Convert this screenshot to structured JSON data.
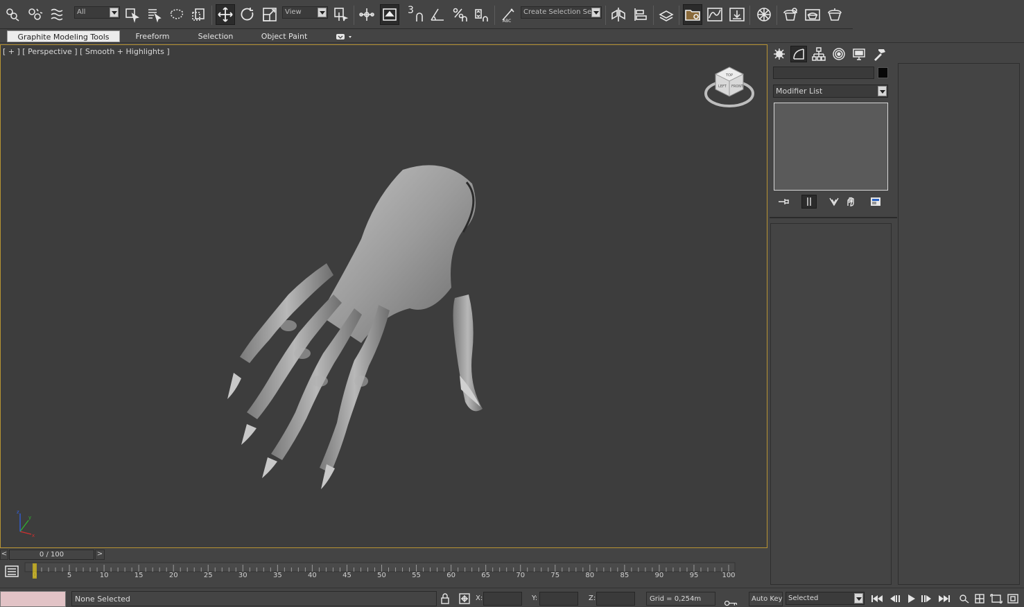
{
  "toolbar": {
    "selection_filter": "All",
    "ref_coord_system": "View",
    "named_selection_set": "Create Selection Se",
    "snap_label": "3",
    "icons": [
      "link-icon",
      "unlink-icon",
      "bind-spacewarp-icon",
      "select-object-icon",
      "select-by-name-icon",
      "rect-selection-icon",
      "window-crossing-icon",
      "select-move-icon",
      "select-rotate-icon",
      "select-scale-icon",
      "use-pivot-icon",
      "select-manipulate-icon",
      "keyboard-shortcut-icon",
      "snaps-toggle-icon",
      "angle-snap-icon",
      "percent-snap-icon",
      "spinner-snap-icon",
      "edit-named-selection-icon",
      "mirror-icon",
      "align-icon",
      "layer-manager-icon",
      "scene-explorer-icon",
      "curve-editor-icon",
      "schematic-view-icon",
      "material-editor-icon",
      "render-setup-icon",
      "rendered-frame-icon",
      "render-production-icon"
    ]
  },
  "ribbon": {
    "tabs": [
      {
        "label": "Graphite Modeling Tools",
        "active": true
      },
      {
        "label": "Freeform",
        "active": false
      },
      {
        "label": "Selection",
        "active": false
      },
      {
        "label": "Object Paint",
        "active": false
      }
    ]
  },
  "viewport": {
    "label": "[ + ] [ Perspective ] [ Smooth + Highlights ]",
    "border_color": "#b89433",
    "viewcube_faces": [
      "TOP",
      "FRONT",
      "LEFT"
    ],
    "axis_labels": [
      "x",
      "y",
      "z"
    ]
  },
  "command_panel": {
    "tabs": [
      "create-icon",
      "modify-icon",
      "hierarchy-icon",
      "motion-icon",
      "display-icon",
      "utilities-icon"
    ],
    "active_tab": 1,
    "object_name": "",
    "object_color": "#080808",
    "modifier_list": "Modifier List",
    "stack_tools": [
      "pin-stack-icon",
      "show-end-result-icon",
      "make-unique-icon",
      "remove-modifier-icon",
      "configure-modifier-sets-icon"
    ]
  },
  "timeline": {
    "frame_display": "0 / 100",
    "prev_label": "<",
    "next_label": ">",
    "ticks": [
      "0",
      "5",
      "10",
      "15",
      "20",
      "25",
      "30",
      "35",
      "40",
      "45",
      "50",
      "55",
      "60",
      "65",
      "70",
      "75",
      "80",
      "85",
      "90",
      "95",
      "100"
    ],
    "current_frame": 0,
    "total_frames": 100
  },
  "statusbar": {
    "message": "None Selected",
    "x_label": "X:",
    "y_label": "Y:",
    "z_label": "Z:",
    "x_value": "",
    "y_value": "",
    "z_value": "",
    "grid": "Grid = 0,254m",
    "auto_key": "Auto Key",
    "set_key_filter": "Selected",
    "maxscript_color": "#e2c3c6"
  }
}
